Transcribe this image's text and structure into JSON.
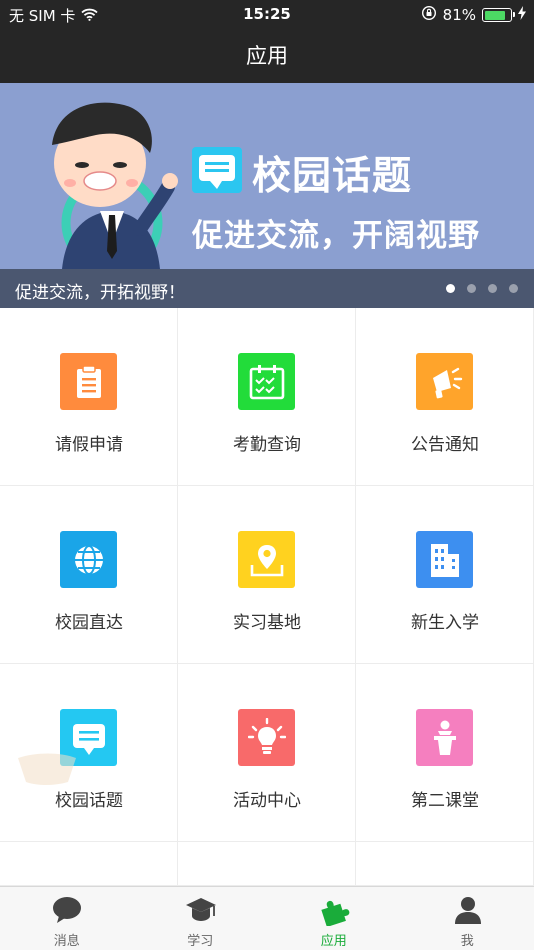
{
  "status_bar": {
    "carrier": "无 SIM 卡",
    "time": "15:25",
    "battery": "81%",
    "battery_level": 0.81
  },
  "nav": {
    "title": "应用"
  },
  "banner": {
    "headline": "校园话题",
    "subline": "促进交流，开阔视野",
    "caption": "促进交流，开拓视野！",
    "page_count": 4,
    "active_page": 1
  },
  "grid": {
    "items": [
      {
        "label": "请假申请",
        "color": "#ff8b3d",
        "icon": "clipboard-icon"
      },
      {
        "label": "考勤查询",
        "color": "#22dc3a",
        "icon": "calendar-icon"
      },
      {
        "label": "公告通知",
        "color": "#ffa42b",
        "icon": "megaphone-icon"
      },
      {
        "label": "校园直达",
        "color": "#1aa5e8",
        "icon": "globe-icon"
      },
      {
        "label": "实习基地",
        "color": "#ffd21f",
        "icon": "map-pin-icon"
      },
      {
        "label": "新生入学",
        "color": "#3d8ff0",
        "icon": "building-icon"
      },
      {
        "label": "校园话题",
        "color": "#24c8f2",
        "icon": "chat-bubble-icon"
      },
      {
        "label": "活动中心",
        "color": "#f86a6a",
        "icon": "lightbulb-icon"
      },
      {
        "label": "第二课堂",
        "color": "#f57fbf",
        "icon": "podium-icon"
      }
    ]
  },
  "tabbar": {
    "tabs": [
      {
        "label": "消息",
        "icon": "chat-icon"
      },
      {
        "label": "学习",
        "icon": "graduation-cap-icon"
      },
      {
        "label": "应用",
        "icon": "puzzle-icon",
        "active": true
      },
      {
        "label": "我",
        "icon": "person-icon"
      }
    ],
    "active_color": "#1aac3a"
  }
}
